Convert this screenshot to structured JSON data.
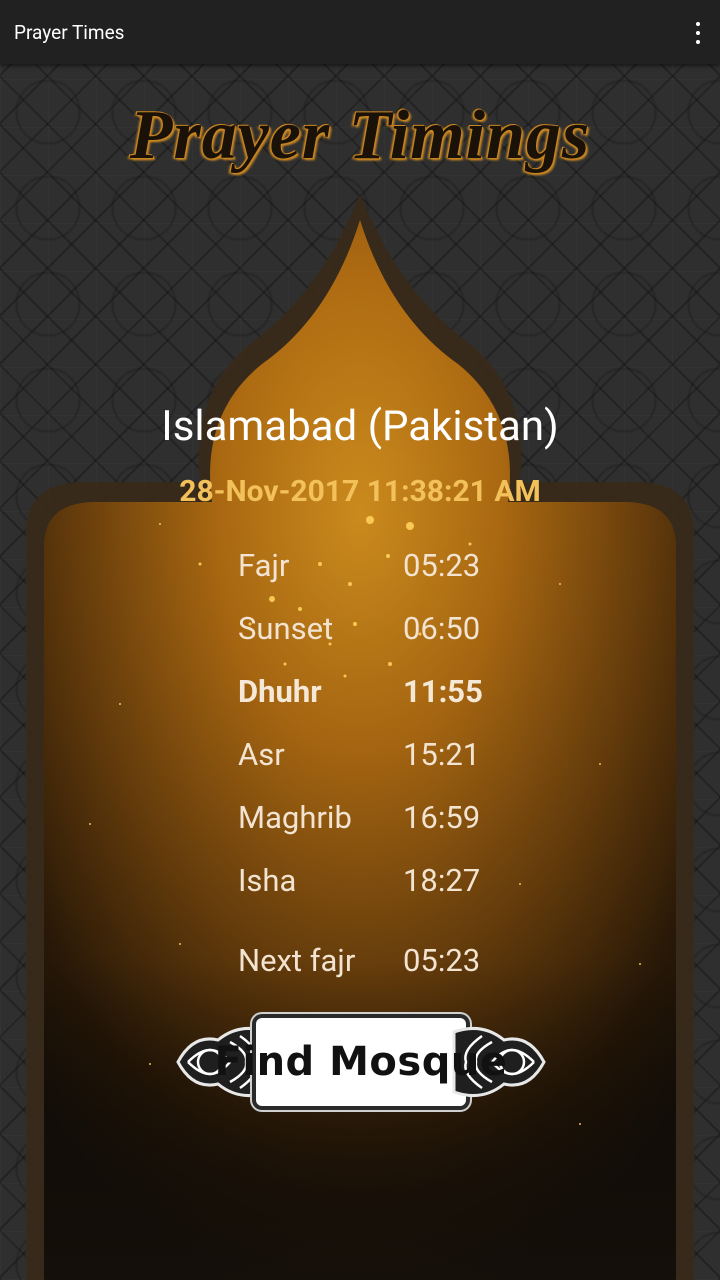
{
  "appbar": {
    "title": "Prayer Times",
    "overflow_icon": "more-vert-icon"
  },
  "header": {
    "title": "Prayer Timings"
  },
  "location": {
    "city": "Islamabad (Pakistan)",
    "datetime": "28-Nov-2017 11:38:21 AM"
  },
  "prayers": [
    {
      "name": "Fajr",
      "time": "05:23",
      "active": false
    },
    {
      "name": "Sunset",
      "time": "06:50",
      "active": false
    },
    {
      "name": "Dhuhr",
      "time": "11:55",
      "active": true
    },
    {
      "name": "Asr",
      "time": "15:21",
      "active": false
    },
    {
      "name": "Maghrib",
      "time": "16:59",
      "active": false
    },
    {
      "name": "Isha",
      "time": "18:27",
      "active": false
    }
  ],
  "next": {
    "name": "Next fajr",
    "time": "05:23"
  },
  "actions": {
    "find_mosque": "Find Mosque"
  },
  "colors": {
    "appbar": "#212121",
    "arch_gold": "#c07a14",
    "datetime": "#f3c15a",
    "prayer_text": "#f3e4d2"
  }
}
